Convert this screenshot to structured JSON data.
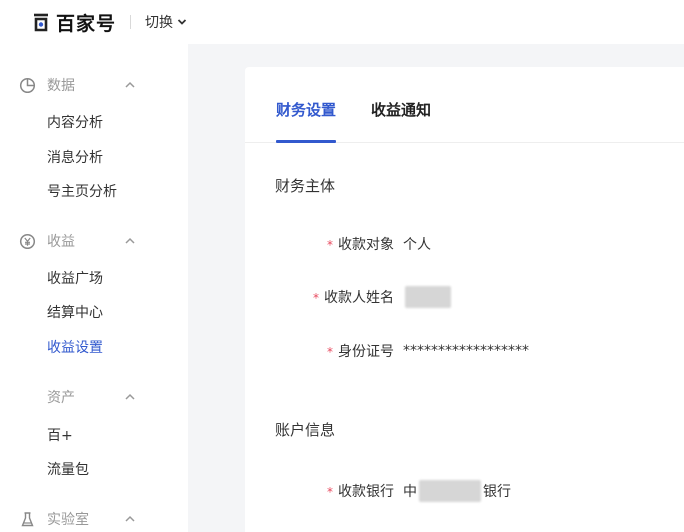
{
  "header": {
    "logo_text": "百家号",
    "switch_label": "切换"
  },
  "sidebar": {
    "groups": [
      {
        "label": "数据",
        "icon": "pie-chart-icon",
        "items": [
          "内容分析",
          "消息分析",
          "号主页分析"
        ]
      },
      {
        "label": "收益",
        "icon": "yen-circle-icon",
        "items": [
          "收益广场",
          "结算中心",
          "收益设置"
        ]
      },
      {
        "label": "资产",
        "icon": "",
        "items": [
          "百+",
          "流量包"
        ]
      },
      {
        "label": "实验室",
        "icon": "flask-icon",
        "items": []
      }
    ],
    "active_item": "收益设置"
  },
  "tabs": [
    {
      "label": "财务设置",
      "active": true
    },
    {
      "label": "收益通知",
      "active": false
    }
  ],
  "finance": {
    "section1_title": "财务主体",
    "fields": [
      {
        "label": "收款对象",
        "value": "个人"
      },
      {
        "label": "收款人姓名",
        "value": ""
      },
      {
        "label": "身份证号",
        "value": "******************"
      }
    ],
    "section2_title": "账户信息",
    "bank": {
      "label": "收款银行",
      "value_prefix": "中",
      "value_suffix": "银行"
    }
  },
  "colors": {
    "accent": "#3259ce",
    "required": "#e8495e",
    "muted": "#999999"
  }
}
